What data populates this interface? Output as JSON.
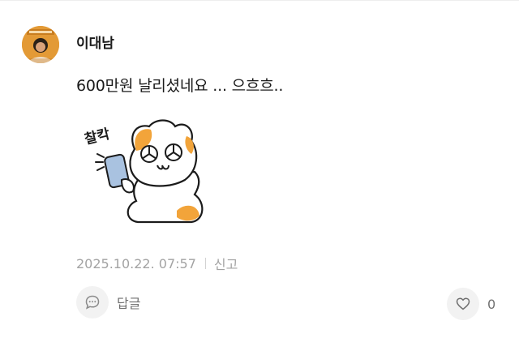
{
  "comment": {
    "author": "이대남",
    "text": "600만원 날리셨네요 ... 으흐흐..",
    "sticker_text": "찰칵",
    "timestamp": "2025.10.22. 07:57",
    "report_label": "신고",
    "reply_label": "답글",
    "like_count": "0"
  },
  "colors": {
    "sticker_accent": "#f2a43a",
    "meta_gray": "#a3a3a3",
    "button_bg": "#f2f2f2"
  },
  "icons": {
    "reply": "speech-bubble-icon",
    "like": "heart-outline-icon"
  }
}
